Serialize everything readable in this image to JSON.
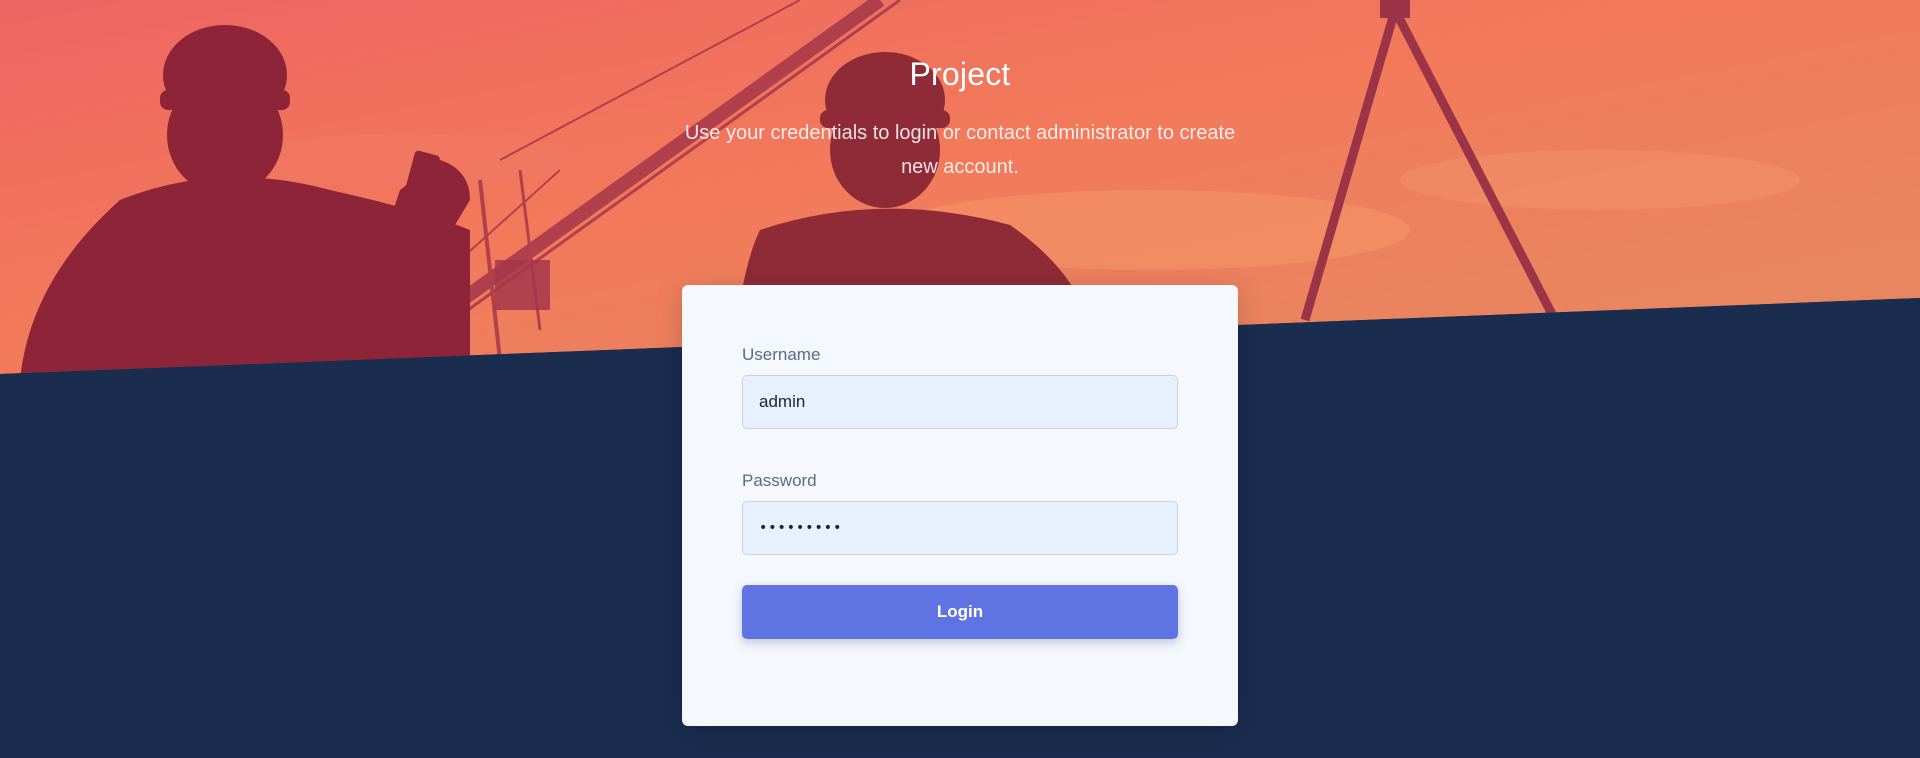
{
  "header": {
    "title": "Project",
    "subtitle": "Use your credentials to login or contact administrator to create new account."
  },
  "login": {
    "username_label": "Username",
    "username_value": "admin",
    "password_label": "Password",
    "password_value": "123456789",
    "button_label": "Login"
  },
  "colors": {
    "background_navy": "#1a2d4f",
    "sunset_top": "#ef6a5f",
    "sunset_bottom": "#f48a58",
    "silhouette": "#8e2438",
    "card": "#f5f8fc",
    "input_bg": "#e8f0fe",
    "button": "#5f73e2"
  }
}
